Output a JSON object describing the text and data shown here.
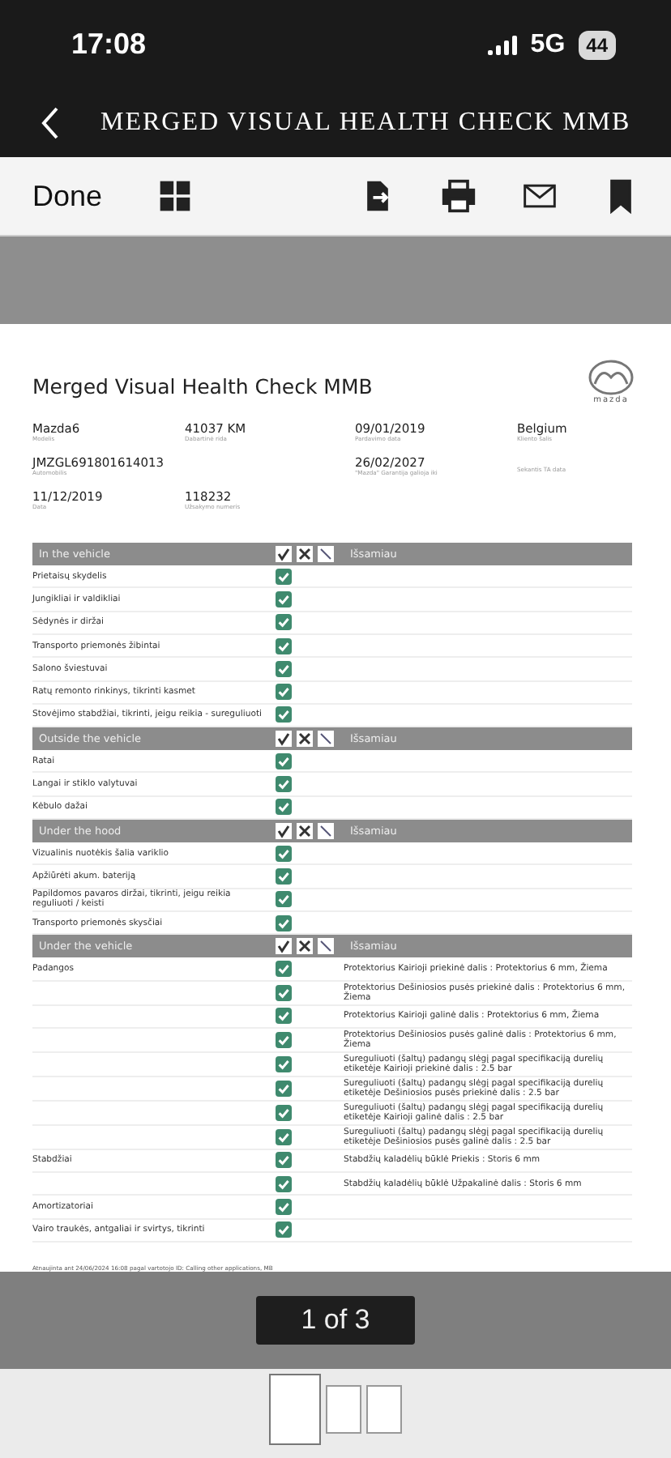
{
  "status_bar": {
    "time": "17:08",
    "network": "5G",
    "battery": "44"
  },
  "nav": {
    "title": "MERGED VISUAL HEALTH CHECK MMB"
  },
  "toolbar": {
    "done": "Done"
  },
  "document": {
    "title": "Merged Visual Health Check MMB",
    "brand": "mazda",
    "field_rows": [
      [
        {
          "value": "Mazda6",
          "caption": "Modelis"
        },
        {
          "value": "41037   KM",
          "caption": "Dabartinė rida"
        },
        {
          "value": "09/01/2019",
          "caption": "Pardavimo data"
        },
        {
          "value": "Belgium",
          "caption": "Kliento šalis"
        }
      ],
      [
        {
          "value": "JMZGL691801614013",
          "caption": "Automobilis"
        },
        {},
        {
          "value": "26/02/2027",
          "caption": "\"Mazda\" Garantija galioja iki"
        },
        {
          "caption": "Sekantis TA data"
        }
      ],
      [
        {
          "value": "11/12/2019",
          "caption": "Data"
        },
        {
          "value": "118232",
          "caption": "Užsakymo numeris"
        },
        {},
        {}
      ]
    ],
    "sections": [
      {
        "title": "In the vehicle",
        "detail_heading": "Išsamiau",
        "rows": [
          {
            "item": "Prietaisų skydelis",
            "checked": true
          },
          {
            "item": "Jungikliai ir valdikliai",
            "checked": true
          },
          {
            "item": "Sėdynės ir diržai",
            "checked": true
          },
          {
            "item": "Transporto priemonės žibintai",
            "checked": true
          },
          {
            "item": "Salono šviestuvai",
            "checked": true
          },
          {
            "item": "Ratų remonto rinkinys, tikrinti kasmet",
            "checked": true
          },
          {
            "item": "Stovėjimo stabdžiai, tikrinti, jeigu reikia - sureguliuoti",
            "checked": true
          }
        ]
      },
      {
        "title": "Outside the vehicle",
        "detail_heading": "Išsamiau",
        "rows": [
          {
            "item": "Ratai",
            "checked": true
          },
          {
            "item": "Langai ir stiklo valytuvai",
            "checked": true
          },
          {
            "item": "Kėbulo dažai",
            "checked": true
          }
        ]
      },
      {
        "title": "Under the hood",
        "detail_heading": "Išsamiau",
        "rows": [
          {
            "item": "Vizualinis nuotėkis šalia variklio",
            "checked": true
          },
          {
            "item": "Apžiūrėti akum. bateriją",
            "checked": true
          },
          {
            "item": "Papildomos pavaros diržai, tikrinti, jeigu reikia reguliuoti / keisti",
            "checked": true
          },
          {
            "item": "Transporto priemonės skysčiai",
            "checked": true
          }
        ]
      },
      {
        "title": "Under the vehicle",
        "detail_heading": "Išsamiau",
        "rows": [
          {
            "item": "Padangos",
            "checked": true,
            "detail": "Protektorius Kairioji priekinė dalis : Protektorius 6 mm, Žiema"
          },
          {
            "checked": true,
            "detail": "Protektorius Dešiniosios pusės priekinė dalis : Protektorius 6 mm, Žiema"
          },
          {
            "checked": true,
            "detail": "Protektorius  Kairioji galinė dalis : Protektorius 6 mm, Žiema"
          },
          {
            "checked": true,
            "detail": "Protektorius Dešiniosios pusės galinė dalis : Protektorius 6 mm, Žiema"
          },
          {
            "checked": true,
            "detail": "Sureguliuoti (šaltų) padangų slėgį pagal specifikaciją durelių etiketėje Kairioji priekinė dalis :   2.5 bar"
          },
          {
            "checked": true,
            "detail": "Sureguliuoti (šaltų) padangų slėgį pagal specifikaciją durelių etiketėje Dešiniosios pusės priekinė dalis :   2.5 bar"
          },
          {
            "checked": true,
            "detail": "Sureguliuoti (šaltų) padangų slėgį pagal specifikaciją durelių etiketėje Kairioji galinė dalis :   2.5 bar"
          },
          {
            "checked": true,
            "detail": "Sureguliuoti (šaltų) padangų slėgį pagal specifikaciją durelių etiketėje Dešiniosios pusės galinė dalis :   2.5 bar"
          },
          {
            "item": "Stabdžiai",
            "checked": true,
            "detail": "Stabdžių kaladėlių būklė Priekis : Storis 6 mm"
          },
          {
            "checked": true,
            "detail": "Stabdžių kaladėlių būklė Užpakalinė dalis : Storis 6 mm"
          },
          {
            "item": "Amortizatoriai",
            "checked": true
          },
          {
            "item": "Vairo traukės, antgaliai ir svirtys, tikrinti",
            "checked": true
          }
        ]
      }
    ],
    "footer_note": "Atnaujinta ant 24/06/2024 16:08 pagal vartotojo ID: Calling other applications, MB"
  },
  "pager": {
    "label": "1 of 3"
  },
  "pages": [
    {
      "selected": true
    },
    {
      "selected": false
    },
    {
      "selected": false
    }
  ]
}
